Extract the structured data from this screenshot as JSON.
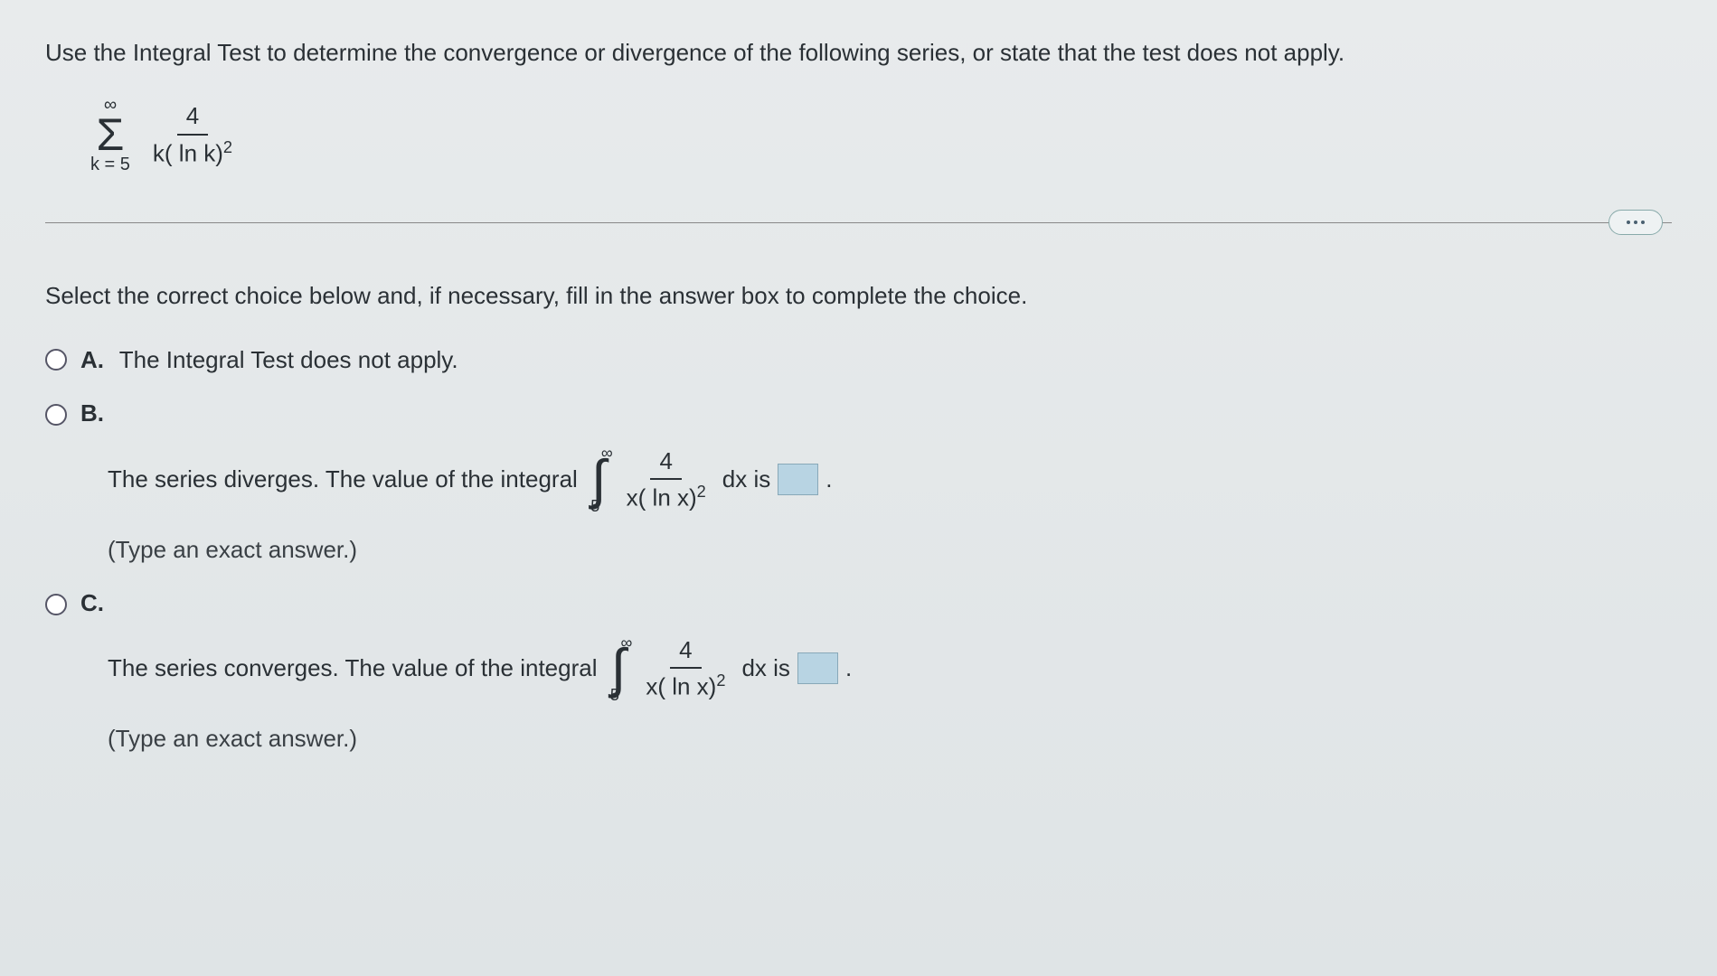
{
  "problem": {
    "statement": "Use the Integral Test to determine the convergence or divergence of the following series, or state that the test does not apply.",
    "sigma_upper": "∞",
    "sigma_lower": "k = 5",
    "frac_num": "4",
    "frac_den_base": "k( ln k)",
    "frac_den_exp": "2"
  },
  "instruction": "Select the correct choice below and, if necessary, fill in the answer box to complete the the choice.",
  "instruction_text": "Select the correct choice below and, if necessary, fill in the answer box to complete the choice.",
  "choices": {
    "a": {
      "letter": "A.",
      "text": "The Integral Test does not apply."
    },
    "b": {
      "letter": "B.",
      "prefix": "The series diverges. The value of the integral",
      "int_upper": "∞",
      "int_lower": "5",
      "int_frac_num": "4",
      "int_frac_den_base": "x( ln x)",
      "int_frac_den_exp": "2",
      "suffix1": "dx is",
      "suffix2": ".",
      "hint": "(Type an exact answer.)"
    },
    "c": {
      "letter": "C.",
      "prefix": "The series converges. The value of the integral",
      "int_upper": "∞",
      "int_lower": "5",
      "int_frac_num": "4",
      "int_frac_den_base": "x( ln x)",
      "int_frac_den_exp": "2",
      "suffix1": "dx is",
      "suffix2": ".",
      "hint": "(Type an exact answer.)"
    }
  }
}
